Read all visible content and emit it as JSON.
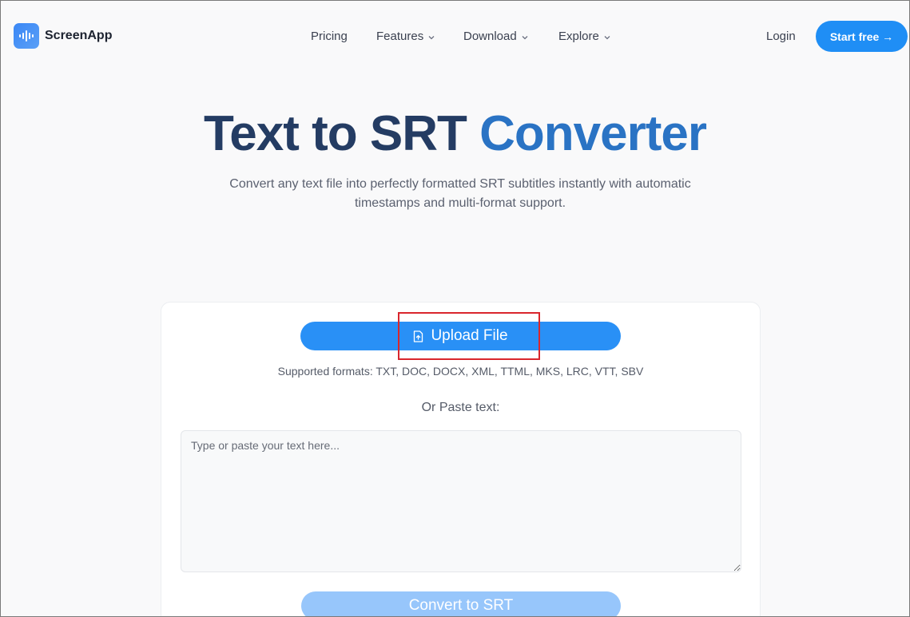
{
  "header": {
    "brand_name": "ScreenApp",
    "nav": [
      {
        "label": "Pricing",
        "has_dropdown": false
      },
      {
        "label": "Features",
        "has_dropdown": true
      },
      {
        "label": "Download",
        "has_dropdown": true
      },
      {
        "label": "Explore",
        "has_dropdown": true
      }
    ],
    "login_label": "Login",
    "start_label": "Start free →"
  },
  "hero": {
    "title_part1": "Text to SRT",
    "title_part2": "Converter",
    "subtitle": "Convert any text file into perfectly formatted SRT subtitles instantly with automatic timestamps and multi-format support."
  },
  "converter": {
    "upload_label": "Upload File",
    "formats_text": "Supported formats: TXT, DOC, DOCX, XML, TTML, MKS, LRC, VTT, SBV",
    "or_paste_label": "Or Paste text:",
    "textarea_placeholder": "Type or paste your text here...",
    "textarea_value": "",
    "convert_label": "Convert to SRT"
  },
  "colors": {
    "accent": "#1f8ef5",
    "title_dark": "#243c63",
    "title_blue": "#2a73c4",
    "convert_disabled": "#97c6fb",
    "highlight_box": "#d9262c"
  },
  "icons": {
    "logo": "audio-wave-icon",
    "chevron": "chevron-down-icon",
    "upload": "file-upload-icon"
  }
}
